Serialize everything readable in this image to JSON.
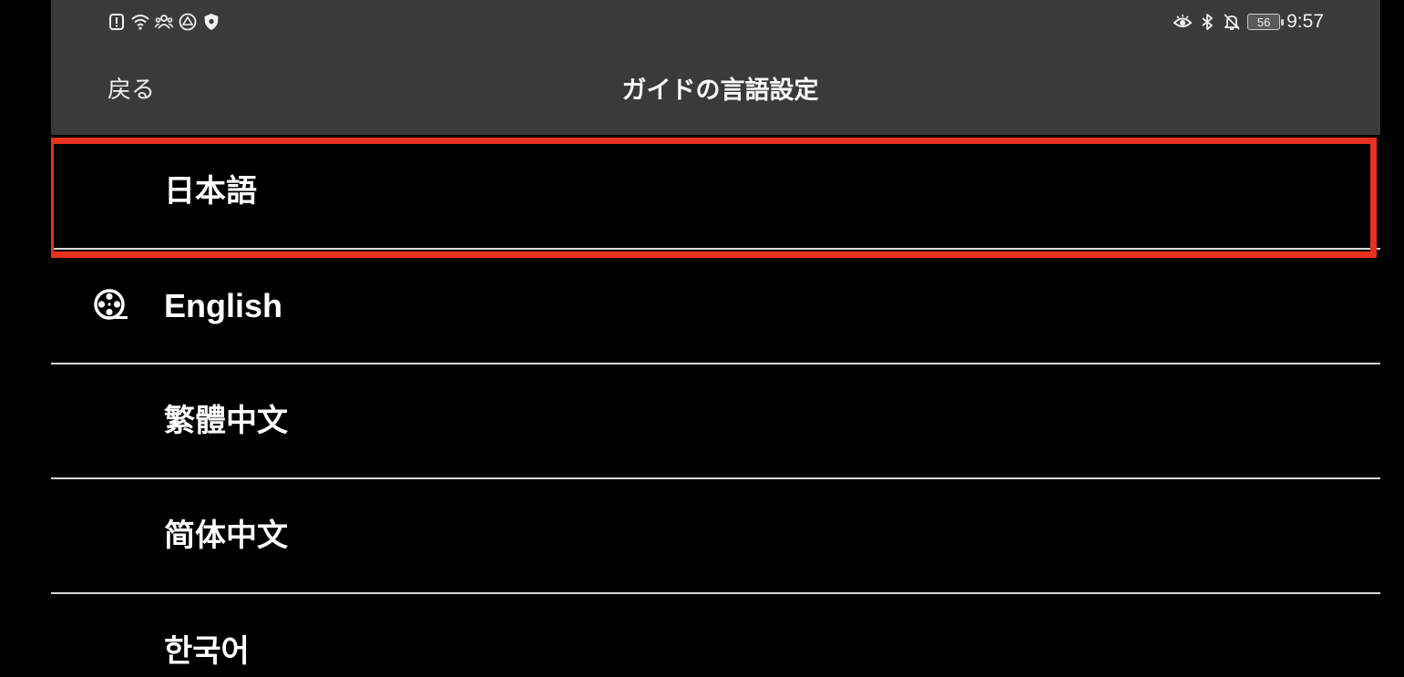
{
  "status_bar": {
    "left_icons": [
      "alert-icon",
      "wifi-icon",
      "people-icon",
      "drive-icon",
      "shield-icon"
    ],
    "right_icons": [
      "eye-icon",
      "bluetooth-icon",
      "bell-off-icon"
    ],
    "battery_level": "56",
    "time": "9:57"
  },
  "header": {
    "back_label": "戻る",
    "title": "ガイドの言語設定"
  },
  "languages": [
    {
      "label": "日本語",
      "selected": false
    },
    {
      "label": "English",
      "selected": true,
      "icon": "film-reel-icon"
    },
    {
      "label": "繁體中文",
      "selected": false
    },
    {
      "label": "简体中文",
      "selected": false
    },
    {
      "label": "한국어",
      "selected": false
    }
  ],
  "colors": {
    "header_bg": "#3a3a3a",
    "list_bg": "#000000",
    "divider": "#d8d8d8",
    "highlight": "#e8321e"
  }
}
